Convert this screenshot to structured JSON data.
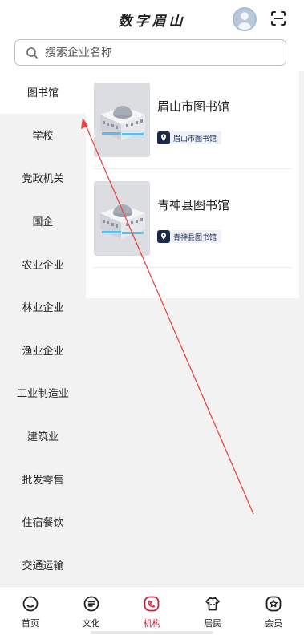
{
  "header": {
    "title": "数字眉山",
    "avatar_icon": "user-avatar-icon",
    "scan_icon": "scan-icon"
  },
  "search": {
    "placeholder": "搜索企业名称",
    "value": ""
  },
  "sidebar": {
    "items": [
      {
        "label": "图书馆",
        "active": true
      },
      {
        "label": "学校"
      },
      {
        "label": "党政机关"
      },
      {
        "label": "国企"
      },
      {
        "label": "农业企业"
      },
      {
        "label": "林业企业"
      },
      {
        "label": "渔业企业"
      },
      {
        "label": "工业制造业"
      },
      {
        "label": "建筑业"
      },
      {
        "label": "批发零售"
      },
      {
        "label": "住宿餐饮"
      },
      {
        "label": "交通运输"
      }
    ]
  },
  "list": {
    "items": [
      {
        "name": "眉山市图书馆",
        "tag": "眉山市图书馆",
        "tag_icon": "location-pin-icon"
      },
      {
        "name": "青神县图书馆",
        "tag": "青神县图书馆",
        "tag_icon": "location-pin-icon"
      }
    ]
  },
  "tabbar": {
    "active_color": "#c8243f",
    "items": [
      {
        "label": "首页",
        "icon": "home-icon"
      },
      {
        "label": "文化",
        "icon": "culture-icon"
      },
      {
        "label": "机构",
        "icon": "institution-icon",
        "active": true
      },
      {
        "label": "居民",
        "icon": "resident-icon"
      },
      {
        "label": "会员",
        "icon": "member-icon"
      }
    ]
  },
  "annotation": {
    "color": "#e8474a"
  }
}
